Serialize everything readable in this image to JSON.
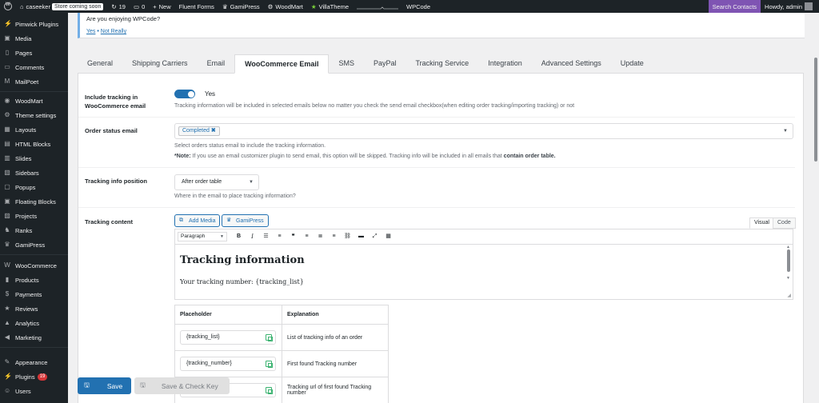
{
  "adminbar": {
    "site_name": "caseeker",
    "store_badge": "Store coming soon",
    "updates_count": "19",
    "comments_count": "0",
    "new_label": "New",
    "items": [
      "Fluent Forms",
      "GamiPress",
      "WoodMart",
      "VillaTheme"
    ],
    "wpcode": "WPCode",
    "search_contacts": "Search Contacts",
    "howdy": "Howdy, admin"
  },
  "sidebar": {
    "items": [
      {
        "label": "Pimwick Plugins",
        "icon": "plug-icon"
      },
      {
        "label": "Media",
        "icon": "media-icon"
      },
      {
        "label": "Pages",
        "icon": "page-icon"
      },
      {
        "label": "Comments",
        "icon": "comment-icon"
      },
      {
        "label": "MailPoet",
        "icon": "mail-icon"
      },
      {
        "label": "WoodMart",
        "icon": "woodmart-icon"
      },
      {
        "label": "Theme settings",
        "icon": "settings-icon"
      },
      {
        "label": "Layouts",
        "icon": "layout-icon"
      },
      {
        "label": "HTML Blocks",
        "icon": "html-icon"
      },
      {
        "label": "Slides",
        "icon": "slides-icon"
      },
      {
        "label": "Sidebars",
        "icon": "sidebar-icon"
      },
      {
        "label": "Popups",
        "icon": "popup-icon"
      },
      {
        "label": "Floating Blocks",
        "icon": "floating-icon"
      },
      {
        "label": "Projects",
        "icon": "projects-icon"
      },
      {
        "label": "Ranks",
        "icon": "ranks-icon"
      },
      {
        "label": "GamiPress",
        "icon": "gamipress-icon"
      },
      {
        "label": "WooCommerce",
        "icon": "woo-icon"
      },
      {
        "label": "Products",
        "icon": "products-icon"
      },
      {
        "label": "Payments",
        "icon": "payments-icon"
      },
      {
        "label": "Reviews",
        "icon": "star-icon"
      },
      {
        "label": "Analytics",
        "icon": "analytics-icon"
      },
      {
        "label": "Marketing",
        "icon": "marketing-icon"
      },
      {
        "label": "Appearance",
        "icon": "appearance-icon"
      },
      {
        "label": "Plugins",
        "icon": "plugins-icon",
        "badge": "19"
      },
      {
        "label": "Users",
        "icon": "users-icon"
      }
    ]
  },
  "notice": {
    "question": "Are you enjoying WPCode?",
    "yes": "Yes",
    "separator": "•",
    "not_really": "Not Really"
  },
  "tabs": [
    "General",
    "Shipping Carriers",
    "Email",
    "WooCommerce Email",
    "SMS",
    "PayPal",
    "Tracking Service",
    "Integration",
    "Advanced Settings",
    "Update"
  ],
  "active_tab": "WooCommerce Email",
  "settings": {
    "include_tracking": {
      "label": "Include tracking in WooCommerce email",
      "toggle_value": "Yes",
      "description": "Tracking information will be included in selected emails below no matter you check the send email checkbox(when editing order tracking/importing tracking) or not"
    },
    "order_status_email": {
      "label": "Order status email",
      "selected": "Completed",
      "description": "Select orders status email to include the tracking information.",
      "note_prefix": "*Note:",
      "note_text": " If you use an email customizer plugin to send email, this option will be skipped. Tracking info will be included in all emails that ",
      "note_strong": "contain order table."
    },
    "tracking_info_position": {
      "label": "Tracking info position",
      "selected": "After order table",
      "description": "Where in the email to place tracking information?"
    },
    "tracking_content": {
      "label": "Tracking content",
      "add_media": "Add Media",
      "gamipress": "GamiPress",
      "visual_tab": "Visual",
      "code_tab": "Code",
      "format_select": "Paragraph",
      "heading": "Tracking information",
      "body": "Your tracking number: {tracking_list}"
    }
  },
  "placeholder_table": {
    "headers": [
      "Placeholder",
      "Explanation"
    ],
    "rows": [
      {
        "placeholder": "{tracking_list}",
        "explanation": "List of tracking info of an order"
      },
      {
        "placeholder": "{tracking_number}",
        "explanation": "First found Tracking number"
      },
      {
        "placeholder": "",
        "explanation": "Tracking url of first found Tracking number"
      }
    ]
  },
  "buttons": {
    "save": "Save",
    "save_check": "Save & Check Key"
  }
}
